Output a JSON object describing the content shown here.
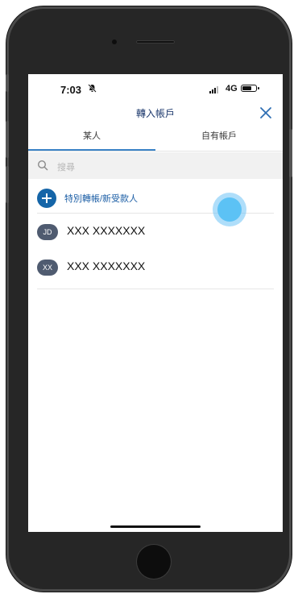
{
  "status": {
    "time": "7:03",
    "network": "4G",
    "battery_level": 0.7,
    "silent_icon": "bell-slash-icon"
  },
  "header": {
    "title": "轉入帳戶",
    "close_icon": "close-icon"
  },
  "tabs": [
    {
      "label": "某人",
      "active": true
    },
    {
      "label": "自有帳戶",
      "active": false
    }
  ],
  "search": {
    "placeholder": "搜尋",
    "icon": "search-icon"
  },
  "add_action": {
    "label": "特別轉帳/新受款人",
    "icon": "plus-icon"
  },
  "contacts": [
    {
      "initials": "JD",
      "name": "XXX XXXXXXX"
    },
    {
      "initials": "XX",
      "name": "XXX XXXXXXX"
    }
  ],
  "colors": {
    "accent": "#1565a8",
    "tab_underline": "#3a82c6",
    "avatar": "#4f5b70",
    "touch_indicator": "#5cc2f5"
  }
}
